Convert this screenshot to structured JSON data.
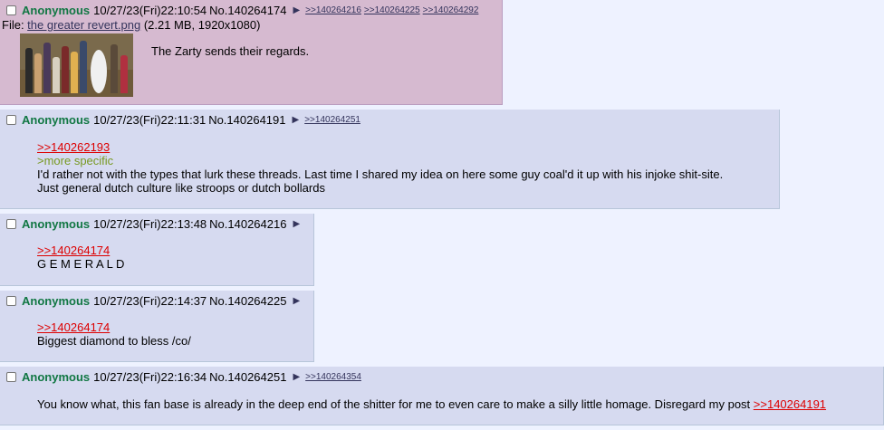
{
  "posts": [
    {
      "name": "Anonymous",
      "date": "10/27/23(Fri)22:10:54",
      "no": "No.140264174",
      "backlinks": [
        ">>140264216",
        ">>140264225",
        ">>140264292"
      ],
      "file": {
        "label": "File: ",
        "filename": "the greater revert.png",
        "meta": " (2.21 MB, 1920x1080)"
      },
      "text": "The Zarty sends their regards."
    },
    {
      "name": "Anonymous",
      "date": "10/27/23(Fri)22:11:31",
      "no": "No.140264191",
      "backlinks": [
        ">>140264251"
      ],
      "quote": ">>140262193",
      "greentext": ">more specific",
      "lines": [
        "I'd rather not with the types that lurk these threads. Last time I shared my idea on here some guy coal'd it up with his injoke shit-site.",
        "Just general dutch culture like stroops or dutch bollards"
      ]
    },
    {
      "name": "Anonymous",
      "date": "10/27/23(Fri)22:13:48",
      "no": "No.140264216",
      "quote": ">>140264174",
      "text": "G E M E R A L D"
    },
    {
      "name": "Anonymous",
      "date": "10/27/23(Fri)22:14:37",
      "no": "No.140264225",
      "quote": ">>140264174",
      "text": "Biggest diamond to bless /co/"
    },
    {
      "name": "Anonymous",
      "date": "10/27/23(Fri)22:16:34",
      "no": "No.140264251",
      "backlinks": [
        ">>140264354"
      ],
      "text": "You know what, this fan base is already in the deep end of the shitter for me to even care to make a silly little homage. Disregard my post ",
      "quote": ">>140264191"
    }
  ],
  "icons": {
    "checkbox": "checkbox-icon",
    "menu": "triangle-menu-icon"
  },
  "colors": {
    "name": "#117743",
    "quote": "#dd0000",
    "greentext": "#789922",
    "reply_bg": "#d6daf0",
    "highlight_bg": "#d6bad0",
    "page_bg": "#eef2ff"
  }
}
